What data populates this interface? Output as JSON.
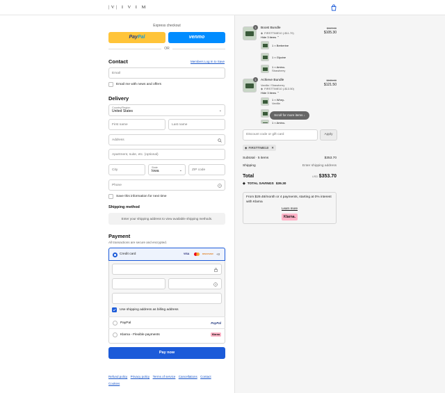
{
  "header": {
    "logo": "|V| I V I M"
  },
  "express": {
    "label": "Express checkout",
    "paypal_a": "Pay",
    "paypal_b": "Pal",
    "venmo": "venmo",
    "or": "OR"
  },
  "contact": {
    "title": "Contact",
    "login_link": "Members Log In to Save",
    "email_placeholder": "Email",
    "news_label": "Email me with news and offers"
  },
  "delivery": {
    "title": "Delivery",
    "country_label": "Country/Region",
    "country_value": "United States",
    "first_name": "First name",
    "last_name": "Last name",
    "address": "Address",
    "apartment": "Apartment, suite, etc. (optional)",
    "city": "City",
    "state_label": "State",
    "state_value": "Iowa",
    "zip": "ZIP code",
    "phone": "Phone",
    "save_label": "Save this information for next time"
  },
  "shipping": {
    "title": "Shipping method",
    "message": "Enter your shipping address to view available shipping methods."
  },
  "payment": {
    "title": "Payment",
    "subtitle": "All transactions are secure and encrypted.",
    "credit_card": "Credit card",
    "brands": [
      "VISA",
      "MC",
      "DISCOVER"
    ],
    "more": "+3",
    "billing_label": "Use shipping address as billing address",
    "paypal": "PayPal",
    "paypal_logo": "PayPal",
    "klarna": "Klarna - Flexible payments",
    "klarna_logo": "Klarna",
    "pay_now": "Pay now"
  },
  "footer": {
    "links": [
      "Refund policy",
      "Privacy policy",
      "Terms of service",
      "Cancellations",
      "Contact",
      "Cookies"
    ]
  },
  "cart": {
    "items": [
      {
        "qty": "1",
        "name": "Boost Bundle",
        "discount": "FIRSTTIME10 (-$11.70)",
        "toggle": "Hide 3 items",
        "original": "$117.00",
        "price": "$105.30",
        "subitems": [
          {
            "text": "1 × Berberine"
          },
          {
            "text": "1 × Glycine"
          },
          {
            "text": "1 × Amino-",
            "text2": "Strawberry"
          }
        ]
      },
      {
        "qty": "1",
        "name": "Achieve Bundle",
        "variant": "Vanilla / Strawberry",
        "discount": "FIRSTTIME10 (-$13.50)",
        "toggle": "Hide 3 items",
        "original": "$135.00",
        "price": "$121.50",
        "subitems": [
          {
            "text": "1 × Whey-",
            "text2": "Vanilla"
          },
          {
            "text": ""
          },
          {
            "text": "1 × Amino-"
          }
        ]
      }
    ],
    "scroll_label": "Scroll for more items",
    "discount_placeholder": "Discount code or gift card",
    "apply": "Apply",
    "code": "FIRSTTIME10",
    "subtotal_label": "Subtotal · 5 items",
    "subtotal_value": "$353.70",
    "shipping_label": "Shipping",
    "shipping_value": "Enter shipping address",
    "total_label": "Total",
    "currency": "USD",
    "total_value": "$353.70",
    "savings_label": "TOTAL SAVINGS",
    "savings_value": "$39.30",
    "klarna_text": "From $29.48/month or 4 payments, starting at 0% interest with Klarna",
    "learn_more": "Learn more",
    "klarna_logo": "Klarna."
  }
}
